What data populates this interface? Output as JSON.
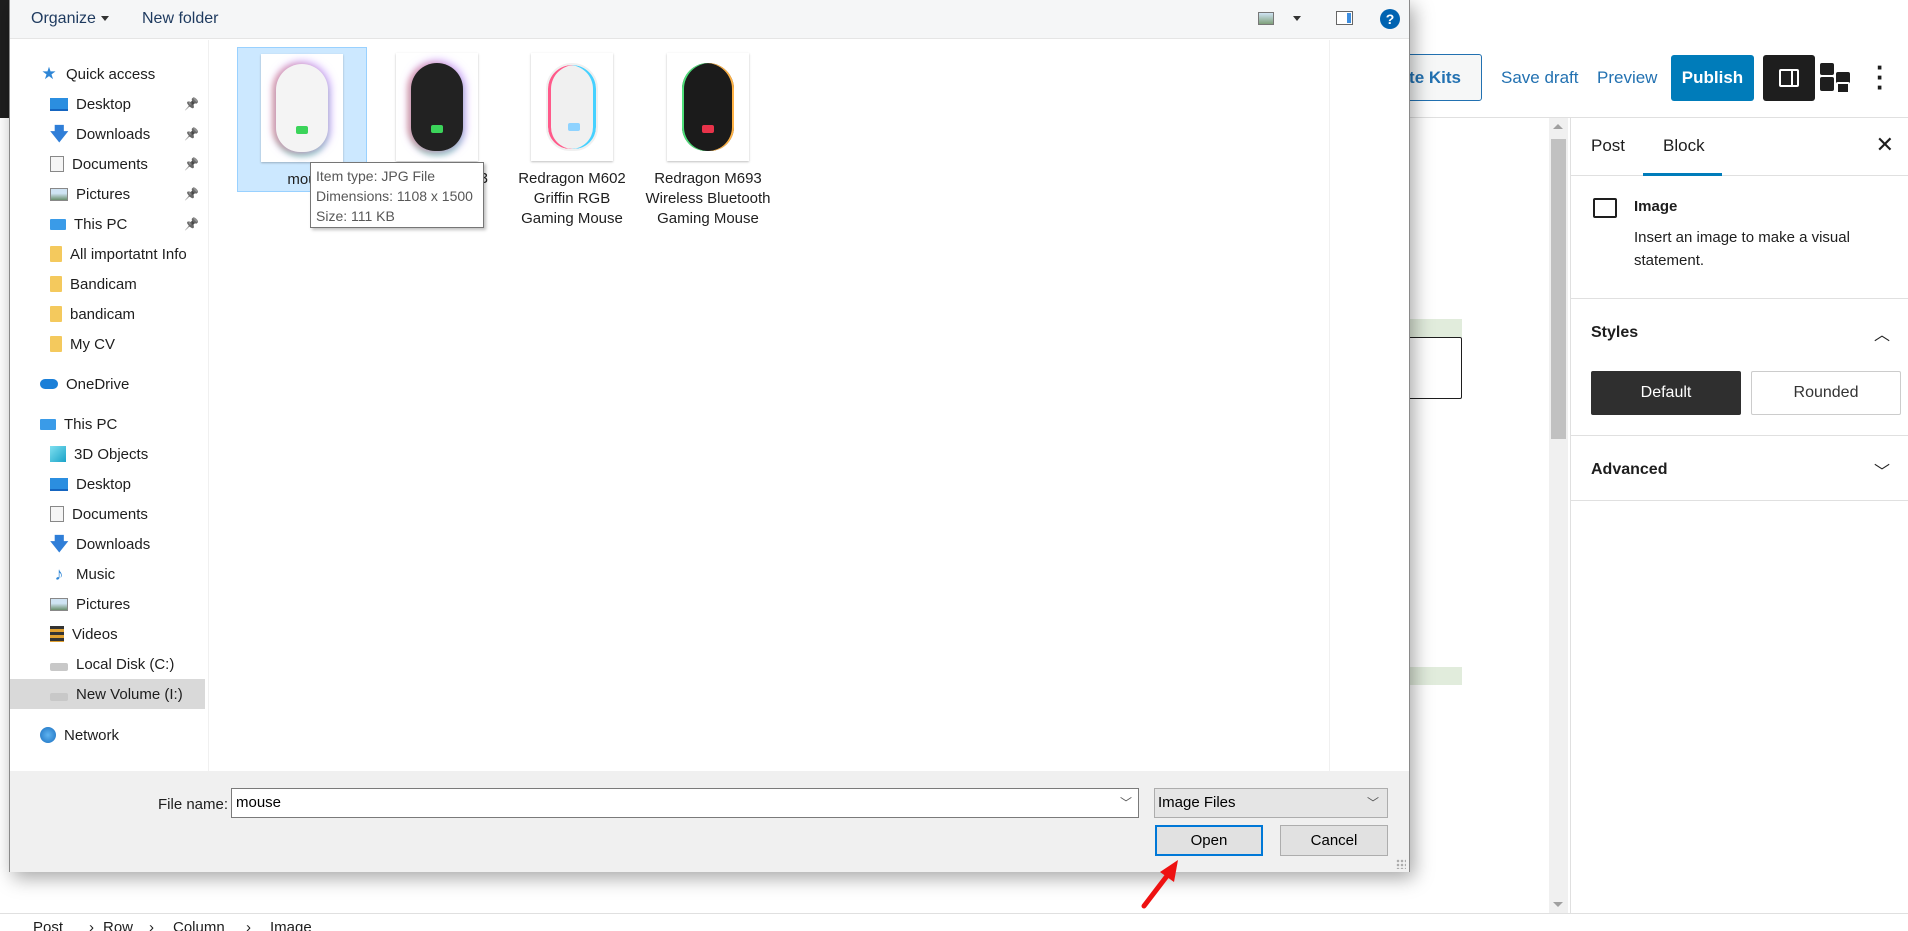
{
  "wp_editor": {
    "header": {
      "template_kits_label": "te Kits",
      "save_draft_label": "Save draft",
      "preview_label": "Preview",
      "publish_label": "Publish"
    },
    "settings_sidebar": {
      "tabs": [
        {
          "label": "Post",
          "active": false
        },
        {
          "label": "Block",
          "active": true
        }
      ],
      "block_card": {
        "title": "Image",
        "description": "Insert an image to make a visual statement."
      },
      "styles_panel": {
        "title": "Styles",
        "expanded": true,
        "options": [
          {
            "label": "Default",
            "selected": true
          },
          {
            "label": "Rounded",
            "selected": false
          }
        ]
      },
      "advanced_panel": {
        "title": "Advanced",
        "expanded": false
      }
    },
    "breadcrumb": [
      "Post",
      "Row",
      "Column",
      "Image"
    ],
    "accent_color": "#007cba"
  },
  "file_dialog": {
    "toolbar": {
      "organize_label": "Organize",
      "new_folder_label": "New folder"
    },
    "nav": {
      "quick_access": {
        "label": "Quick access",
        "items": [
          {
            "label": "Desktop",
            "icon": "desktop-icon",
            "pinned": true
          },
          {
            "label": "Downloads",
            "icon": "downloads-icon",
            "pinned": true
          },
          {
            "label": "Documents",
            "icon": "documents-icon",
            "pinned": true
          },
          {
            "label": "Pictures",
            "icon": "pictures-icon",
            "pinned": true
          },
          {
            "label": "This PC",
            "icon": "this-pc-icon",
            "pinned": true
          },
          {
            "label": "All importatnt Info",
            "icon": "folder-icon",
            "pinned": false
          },
          {
            "label": "Bandicam",
            "icon": "folder-icon",
            "pinned": false
          },
          {
            "label": "bandicam",
            "icon": "folder-icon",
            "pinned": false
          },
          {
            "label": "My CV",
            "icon": "folder-icon",
            "pinned": false
          }
        ]
      },
      "onedrive": {
        "label": "OneDrive"
      },
      "this_pc": {
        "label": "This PC",
        "items": [
          {
            "label": "3D Objects",
            "icon": "3d-objects-icon"
          },
          {
            "label": "Desktop",
            "icon": "desktop-icon"
          },
          {
            "label": "Documents",
            "icon": "documents-icon"
          },
          {
            "label": "Downloads",
            "icon": "downloads-icon"
          },
          {
            "label": "Music",
            "icon": "music-icon"
          },
          {
            "label": "Pictures",
            "icon": "pictures-icon"
          },
          {
            "label": "Videos",
            "icon": "videos-icon"
          },
          {
            "label": "Local Disk (C:)",
            "icon": "local-disk-icon"
          },
          {
            "label": "New Volume (I:)",
            "icon": "drive-icon",
            "selected": true
          }
        ]
      },
      "network": {
        "label": "Network"
      }
    },
    "files": [
      {
        "name": "mou",
        "selected": true
      },
      {
        "name": "3",
        "selected": false
      },
      {
        "name": "Redragon M602 Griffin RGB Gaming Mouse",
        "selected": false
      },
      {
        "name": "Redragon M693 Wireless Bluetooth Gaming Mouse",
        "selected": false
      }
    ],
    "tooltip": {
      "line1": "Item type: JPG File",
      "line2": "Dimensions: 1108 x 1500",
      "line3": "Size: 111 KB"
    },
    "file_name_label": "File name:",
    "file_name_value": "mouse",
    "file_type_value": "Image Files",
    "open_label": "Open",
    "cancel_label": "Cancel"
  }
}
